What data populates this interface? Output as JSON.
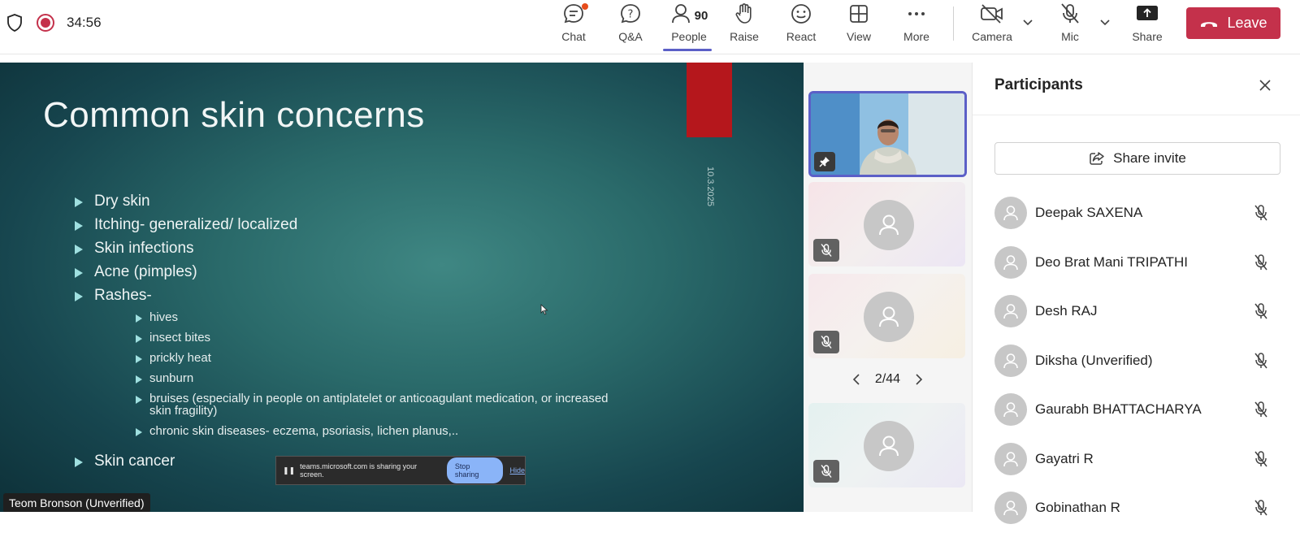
{
  "topbar": {
    "timer": "34:56",
    "buttons": {
      "chat": "Chat",
      "qa": "Q&A",
      "people": "People",
      "people_count": "90",
      "raise": "Raise",
      "react": "React",
      "view": "View",
      "more": "More",
      "camera": "Camera",
      "mic": "Mic",
      "share": "Share"
    },
    "leave": "Leave",
    "accent_color": "#5b5fc7",
    "leave_color": "#c4314b"
  },
  "slide": {
    "title": "Common skin concerns",
    "date": "10.3.2025",
    "bullets": [
      "Dry skin",
      "Itching- generalized/ localized",
      "Skin infections",
      "Acne (pimples)",
      "Rashes-"
    ],
    "sub_bullets": [
      "hives",
      "insect bites",
      "prickly heat",
      "sunburn",
      "bruises (especially in people on antiplatelet or anticoagulant medication, or increased skin fragility)",
      "chronic skin diseases- eczema, psoriasis, lichen planus,.."
    ],
    "last_bullet": "Skin cancer",
    "share_notice": {
      "text": "teams.microsoft.com is sharing your screen.",
      "stop": "Stop sharing",
      "hide": "Hide"
    },
    "presenter": "Teom Bronson (Unverified)"
  },
  "strip": {
    "pager": "2/44"
  },
  "participants": {
    "title": "Participants",
    "invite": "Share invite",
    "list": [
      "Deepak SAXENA",
      "Deo Brat Mani TRIPATHI",
      "Desh RAJ",
      "Diksha (Unverified)",
      "Gaurabh BHATTACHARYA",
      "Gayatri R",
      "Gobinathan R"
    ]
  }
}
